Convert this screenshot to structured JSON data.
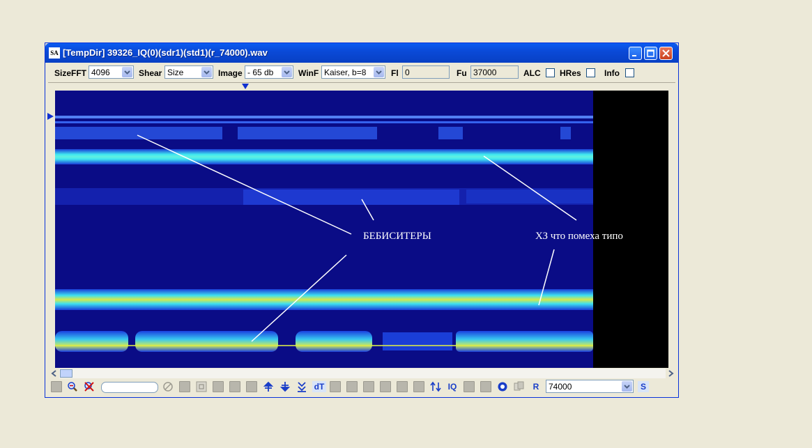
{
  "window": {
    "title": "[TempDir] 39326_IQ(0)(sdr1)(std1)(r_74000).wav",
    "icon_text": "SA"
  },
  "toolbar": {
    "sizefft_label": "SizeFFT",
    "sizefft_value": "4096",
    "shear_label": "Shear",
    "shear_value": "Size",
    "image_label": "Image",
    "image_value": "- 65 db",
    "winf_label": "WinF",
    "winf_value": "Kaiser, b=8",
    "fl_label": "Fl",
    "fl_value": "0",
    "fu_label": "Fu",
    "fu_value": "37000",
    "alc_label": "ALC",
    "alc_checked": false,
    "hres_label": "HRes",
    "hres_checked": false,
    "info_label": "Info",
    "info_checked": false
  },
  "annotations": {
    "babysitters": "БЕБИСИТЕРЫ",
    "interference": "ХЗ что помеха типо"
  },
  "bottombar": {
    "dt_label": "dT",
    "iq_label": "IQ",
    "r_label": "R",
    "s_label": "S",
    "rate_value": "74000"
  },
  "colors": {
    "spectrogram_bg": "#0a0c86",
    "band_strong": "#3ef0f0",
    "band_yellow": "#d8e84a",
    "annotation": "#ffffff",
    "titlebar": "#0a4ad8"
  }
}
